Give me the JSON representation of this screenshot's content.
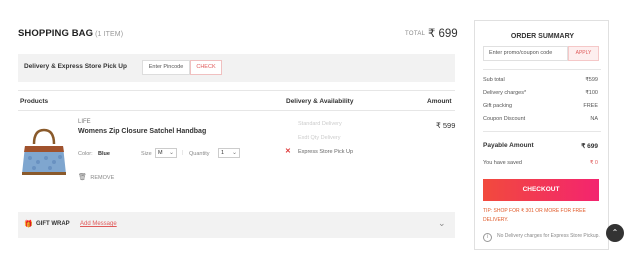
{
  "header": {
    "title": "SHOPPING BAG",
    "item_count": "(1 ITEM)",
    "total_label": "TOTAL",
    "total_value": "₹ 699"
  },
  "pincode": {
    "label": "Delivery & Express Store Pick Up",
    "placeholder": "Enter Pincode",
    "check_label": "CHECK"
  },
  "table": {
    "col_products": "Products",
    "col_delivery": "Delivery & Availability",
    "col_amount": "Amount"
  },
  "item": {
    "brand": "LIFE",
    "name": "Womens Zip Closure Satchel Handbag",
    "color_label": "Color:",
    "color_value": "Blue",
    "size_label": "Size",
    "size_value": "M",
    "qty_label": "Quantity",
    "qty_value": "1",
    "remove_label": "REMOVE",
    "price": "₹ 599",
    "delivery": {
      "standard": "Standard Delivery",
      "express": "Exdt Qty Delivery",
      "store_pickup": "Express Store Pick Up"
    }
  },
  "gift": {
    "label": "GIFT WRAP",
    "add_message": "Add Message"
  },
  "summary": {
    "title": "ORDER SUMMARY",
    "promo_placeholder": "Enter promo/coupon code",
    "apply_label": "APPLY",
    "rows": [
      {
        "label": "Sub total",
        "value": "₹599"
      },
      {
        "label": "Delivery charges*",
        "value": "₹100"
      },
      {
        "label": "Gift packing",
        "value": "FREE"
      },
      {
        "label": "Coupon Discount",
        "value": "NA"
      }
    ],
    "payable_label": "Payable Amount",
    "payable_value": "₹ 699",
    "saved_label": "You have saved",
    "saved_value": "₹ 0",
    "checkout_label": "CHECKOUT",
    "tip": "TIP: SHOP FOR ₹ 301 OR MORE FOR FREE DELIVERY.",
    "info": "No Delivery charges for Express Store Pickup."
  },
  "colors": {
    "accent": "#e05a5a",
    "checkout_start": "#f24a3d",
    "checkout_end": "#f3246f"
  }
}
